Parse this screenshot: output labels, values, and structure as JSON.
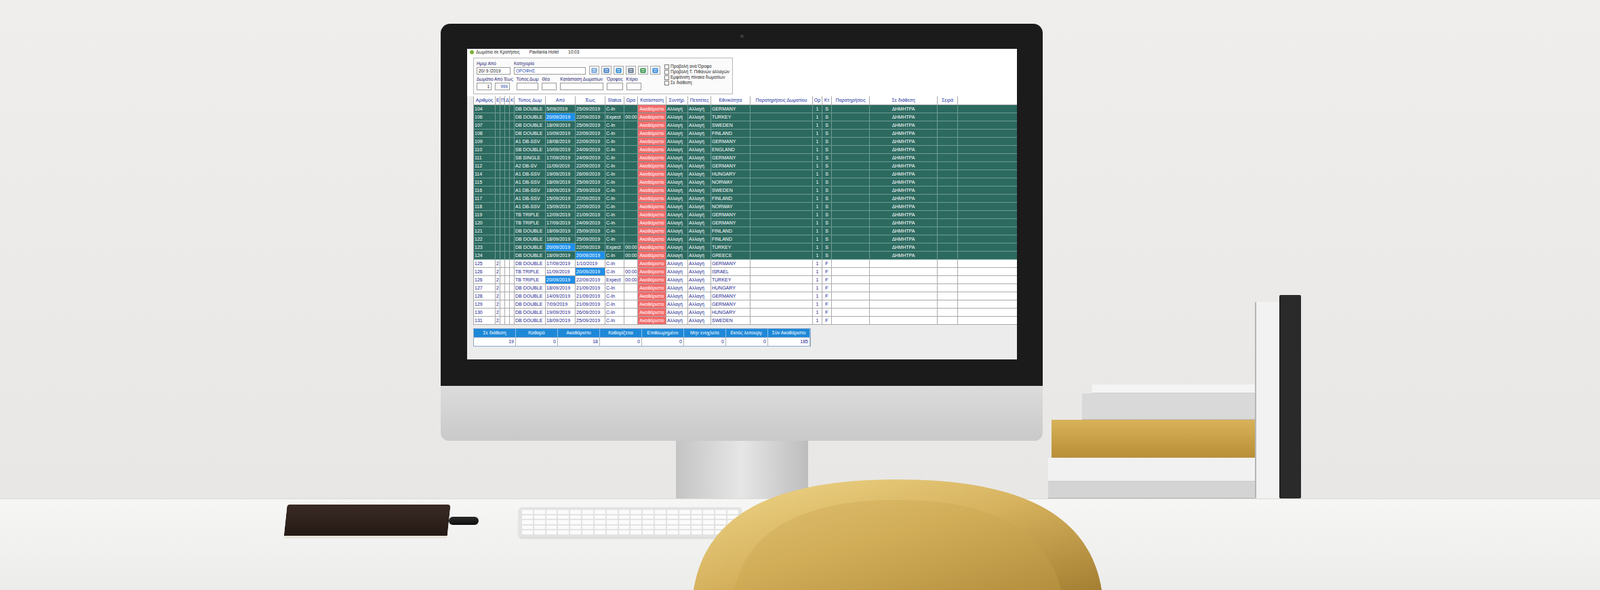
{
  "window": {
    "title": "Δωμάτια σε Κρατήσεις",
    "hotel": "Pavilania Hotel",
    "time": "10:03"
  },
  "filters": {
    "date_label": "Ημερ Από",
    "date": "20/ 9 /2019",
    "category_label": "Κατηγορία",
    "category": "ΟΡΟΦΗΣ",
    "room_range_label": "Δωμάτιο Από Έως",
    "room_from": "1",
    "room_to": "999",
    "fields": [
      {
        "label": "Τύπος Δωμ",
        "value": ""
      },
      {
        "label": "Θέα",
        "value": ""
      },
      {
        "label": "Κατάσταση Δωματίων",
        "value": ""
      },
      {
        "label": "Όροφος",
        "value": ""
      },
      {
        "label": "Κτίριο",
        "value": ""
      }
    ],
    "checkboxes": [
      {
        "label": "Προβολή ανά Όροφο",
        "checked": false
      },
      {
        "label": "Προβολή Τ. Πιθανών αλλαγών",
        "checked": false
      },
      {
        "label": "Εμφάνιση πίνακα δωματίων",
        "checked": false
      },
      {
        "label": "Σε διάθεση",
        "checked": false
      }
    ]
  },
  "table": {
    "columns": [
      "Αριθμός",
      "Ε",
      "Π",
      "Δ",
      "Κ",
      "Τύπος Δωμ",
      "Από",
      "Έως",
      "Status",
      "Ωρα",
      "Κατάσταση",
      "Συντήρ.",
      "Πετσέτες",
      "Εθνικότητα",
      "Παρατηρήσεις Δωματίου",
      "Ορ",
      "Κτ",
      "Παρατηρήσεις",
      "Σε διάθεση",
      "Σειρά"
    ],
    "rows": [
      {
        "cells": [
          "104",
          "",
          "",
          "",
          "",
          "DB DOUBLE",
          "5/09/2019",
          "25/09/2019",
          "C-In",
          "",
          "Ακαθάριστο",
          "Αλλαγή",
          "Αλλαγή",
          "GERMANY",
          "",
          "1",
          "S",
          "",
          "ΔΗΜΗΤΡΑ",
          ""
        ],
        "assigned": true,
        "from_selected": false,
        "to_selected": false
      },
      {
        "cells": [
          "106",
          "",
          "",
          "",
          "",
          "DB DOUBLE",
          "20/09/2019",
          "22/09/2019",
          "Expect",
          "00:00",
          "Ακαθάριστο",
          "Αλλαγή",
          "Αλλαγή",
          "TURKEY",
          "",
          "1",
          "S",
          "",
          "ΔΗΜΗΤΡΑ",
          ""
        ],
        "assigned": true,
        "from_selected": true,
        "to_selected": false
      },
      {
        "cells": [
          "107",
          "",
          "",
          "",
          "",
          "DB DOUBLE",
          "18/09/2019",
          "25/09/2019",
          "C-In",
          "",
          "Ακαθάριστο",
          "Αλλαγή",
          "Αλλαγή",
          "SWEDEN",
          "",
          "1",
          "S",
          "",
          "ΔΗΜΗΤΡΑ",
          ""
        ],
        "assigned": true,
        "from_selected": false,
        "to_selected": false
      },
      {
        "cells": [
          "108",
          "",
          "",
          "",
          "",
          "DB DOUBLE",
          "10/09/2019",
          "22/09/2019",
          "C-In",
          "",
          "Ακαθάριστο",
          "Αλλαγή",
          "Αλλαγή",
          "FINLAND",
          "",
          "1",
          "S",
          "",
          "ΔΗΜΗΤΡΑ",
          ""
        ],
        "assigned": true,
        "from_selected": false,
        "to_selected": false
      },
      {
        "cells": [
          "109",
          "",
          "",
          "",
          "",
          "A1 DB-SSV",
          "18/08/2019",
          "22/09/2019",
          "C-In",
          "",
          "Ακαθάριστο",
          "Αλλαγή",
          "Αλλαγή",
          "GERMANY",
          "",
          "1",
          "S",
          "",
          "ΔΗΜΗΤΡΑ",
          ""
        ],
        "assigned": true,
        "from_selected": false,
        "to_selected": false
      },
      {
        "cells": [
          "110",
          "",
          "",
          "",
          "",
          "SB DOUBLE",
          "10/09/2019",
          "24/09/2019",
          "C-In",
          "",
          "Ακαθάριστο",
          "Αλλαγή",
          "Αλλαγή",
          "ENGLAND",
          "",
          "1",
          "S",
          "",
          "ΔΗΜΗΤΡΑ",
          ""
        ],
        "assigned": true,
        "from_selected": false,
        "to_selected": false
      },
      {
        "cells": [
          "111",
          "",
          "",
          "",
          "",
          "SB SINGLE",
          "17/09/2019",
          "24/09/2019",
          "C-In",
          "",
          "Ακαθάριστο",
          "Αλλαγή",
          "Αλλαγή",
          "GERMANY",
          "",
          "1",
          "S",
          "",
          "ΔΗΜΗΤΡΑ",
          ""
        ],
        "assigned": true,
        "from_selected": false,
        "to_selected": false
      },
      {
        "cells": [
          "112",
          "",
          "",
          "",
          "",
          "A2 DB-SV",
          "11/09/2019",
          "22/09/2019",
          "C-In",
          "",
          "Ακαθάριστο",
          "Αλλαγή",
          "Αλλαγή",
          "GERMANY",
          "",
          "1",
          "S",
          "",
          "ΔΗΜΗΤΡΑ",
          ""
        ],
        "assigned": true,
        "from_selected": false,
        "to_selected": false
      },
      {
        "cells": [
          "114",
          "",
          "",
          "",
          "",
          "A1 DB-SSV",
          "19/09/2019",
          "26/09/2019",
          "C-In",
          "",
          "Ακαθάριστο",
          "Αλλαγή",
          "Αλλαγή",
          "HUNGARY",
          "",
          "1",
          "S",
          "",
          "ΔΗΜΗΤΡΑ",
          ""
        ],
        "assigned": true,
        "from_selected": false,
        "to_selected": false
      },
      {
        "cells": [
          "115",
          "",
          "",
          "",
          "",
          "A1 DB-SSV",
          "18/09/2019",
          "25/09/2019",
          "C-In",
          "",
          "Ακαθάριστο",
          "Αλλαγή",
          "Αλλαγή",
          "NORWAY",
          "",
          "1",
          "S",
          "",
          "ΔΗΜΗΤΡΑ",
          ""
        ],
        "assigned": true,
        "from_selected": false,
        "to_selected": false
      },
      {
        "cells": [
          "116",
          "",
          "",
          "",
          "",
          "A1 DB-SSV",
          "18/09/2019",
          "25/09/2019",
          "C-In",
          "",
          "Ακαθάριστο",
          "Αλλαγή",
          "Αλλαγή",
          "SWEDEN",
          "",
          "1",
          "S",
          "",
          "ΔΗΜΗΤΡΑ",
          ""
        ],
        "assigned": true,
        "from_selected": false,
        "to_selected": false
      },
      {
        "cells": [
          "117",
          "",
          "",
          "",
          "",
          "A1 DB-SSV",
          "15/09/2019",
          "22/09/2019",
          "C-In",
          "",
          "Ακαθάριστο",
          "Αλλαγή",
          "Αλλαγή",
          "FINLAND",
          "",
          "1",
          "S",
          "",
          "ΔΗΜΗΤΡΑ",
          ""
        ],
        "assigned": true,
        "from_selected": false,
        "to_selected": false
      },
      {
        "cells": [
          "118",
          "",
          "",
          "",
          "",
          "A1 DB-SSV",
          "15/09/2019",
          "22/09/2019",
          "C-In",
          "",
          "Ακαθάριστο",
          "Αλλαγή",
          "Αλλαγή",
          "NORWAY",
          "",
          "1",
          "S",
          "",
          "ΔΗΜΗΤΡΑ",
          ""
        ],
        "assigned": true,
        "from_selected": false,
        "to_selected": false
      },
      {
        "cells": [
          "119",
          "",
          "",
          "",
          "",
          "TB TRIPLE",
          "12/09/2019",
          "21/09/2019",
          "C-In",
          "",
          "Ακαθάριστο",
          "Αλλαγή",
          "Αλλαγή",
          "GERMANY",
          "",
          "1",
          "S",
          "",
          "ΔΗΜΗΤΡΑ",
          ""
        ],
        "assigned": true,
        "from_selected": false,
        "to_selected": false
      },
      {
        "cells": [
          "120",
          "",
          "",
          "",
          "",
          "TB TRIPLE",
          "17/09/2019",
          "24/09/2019",
          "C-In",
          "",
          "Ακαθάριστο",
          "Αλλαγή",
          "Αλλαγή",
          "GERMANY",
          "",
          "1",
          "S",
          "",
          "ΔΗΜΗΤΡΑ",
          ""
        ],
        "assigned": true,
        "from_selected": false,
        "to_selected": false
      },
      {
        "cells": [
          "121",
          "",
          "",
          "",
          "",
          "DB DOUBLE",
          "18/09/2019",
          "25/09/2019",
          "C-In",
          "",
          "Ακαθάριστο",
          "Αλλαγή",
          "Αλλαγή",
          "FINLAND",
          "",
          "1",
          "S",
          "",
          "ΔΗΜΗΤΡΑ",
          ""
        ],
        "assigned": true,
        "from_selected": false,
        "to_selected": false
      },
      {
        "cells": [
          "122",
          "",
          "",
          "",
          "",
          "DB DOUBLE",
          "18/09/2019",
          "25/09/2019",
          "C-In",
          "",
          "Ακαθάριστο",
          "Αλλαγή",
          "Αλλαγή",
          "FINLAND",
          "",
          "1",
          "S",
          "",
          "ΔΗΜΗΤΡΑ",
          ""
        ],
        "assigned": true,
        "from_selected": false,
        "to_selected": false
      },
      {
        "cells": [
          "123",
          "",
          "",
          "",
          "",
          "DB DOUBLE",
          "20/09/2019",
          "22/09/2019",
          "Expect",
          "00:00",
          "Ακαθάριστο",
          "Αλλαγή",
          "Αλλαγή",
          "TURKEY",
          "",
          "1",
          "S",
          "",
          "ΔΗΜΗΤΡΑ",
          ""
        ],
        "assigned": true,
        "from_selected": true,
        "to_selected": false
      },
      {
        "cells": [
          "124",
          "",
          "",
          "",
          "",
          "DB DOUBLE",
          "18/09/2019",
          "20/09/2019",
          "C-In",
          "00:00",
          "Ακαθάριστο",
          "Αλλαγή",
          "Αλλαγή",
          "GREECE",
          "",
          "1",
          "S",
          "",
          "ΔΗΜΗΤΡΑ",
          ""
        ],
        "assigned": true,
        "from_selected": false,
        "to_selected": true
      },
      {
        "cells": [
          "125",
          "2",
          "",
          "",
          "",
          "DB DOUBLE",
          "17/09/2019",
          "1/10/2019",
          "C-In",
          "",
          "Ακαθάριστο",
          "Αλλαγή",
          "Αλλαγή",
          "GERMANY",
          "",
          "1",
          "F",
          "",
          "",
          ""
        ],
        "assigned": false,
        "from_selected": false,
        "to_selected": false
      },
      {
        "cells": [
          "126",
          "2",
          "",
          "",
          "",
          "TB TRIPLE",
          "11/09/2019",
          "20/09/2019",
          "C-In",
          "00:00",
          "Ακαθάριστο",
          "Αλλαγή",
          "Αλλαγή",
          "ISRAEL",
          "",
          "1",
          "F",
          "",
          "",
          ""
        ],
        "assigned": false,
        "from_selected": false,
        "to_selected": true
      },
      {
        "cells": [
          "126",
          "2",
          "",
          "",
          "",
          "TB TRIPLE",
          "20/09/2019",
          "22/09/2019",
          "Expect",
          "00:00",
          "Ακαθάριστο",
          "Αλλαγή",
          "Αλλαγή",
          "TURKEY",
          "",
          "1",
          "F",
          "",
          "",
          ""
        ],
        "assigned": false,
        "from_selected": true,
        "to_selected": false
      },
      {
        "cells": [
          "127",
          "2",
          "",
          "",
          "",
          "DB DOUBLE",
          "18/09/2019",
          "21/09/2019",
          "C-In",
          "",
          "Ακαθάριστο",
          "Αλλαγή",
          "Αλλαγή",
          "HUNGARY",
          "",
          "1",
          "F",
          "",
          "",
          ""
        ],
        "assigned": false,
        "from_selected": false,
        "to_selected": false
      },
      {
        "cells": [
          "128",
          "2",
          "",
          "",
          "",
          "DB DOUBLE",
          "14/09/2019",
          "21/09/2019",
          "C-In",
          "",
          "Ακαθάριστο",
          "Αλλαγή",
          "Αλλαγή",
          "GERMANY",
          "",
          "1",
          "F",
          "",
          "",
          ""
        ],
        "assigned": false,
        "from_selected": false,
        "to_selected": false
      },
      {
        "cells": [
          "129",
          "2",
          "",
          "",
          "",
          "DB DOUBLE",
          "7/09/2019",
          "21/09/2019",
          "C-In",
          "",
          "Ακαθάριστο",
          "Αλλαγή",
          "Αλλαγή",
          "GERMANY",
          "",
          "1",
          "F",
          "",
          "",
          ""
        ],
        "assigned": false,
        "from_selected": false,
        "to_selected": false
      },
      {
        "cells": [
          "130",
          "2",
          "",
          "",
          "",
          "DB DOUBLE",
          "19/09/2019",
          "26/09/2019",
          "C-In",
          "",
          "Ακαθάριστο",
          "Αλλαγή",
          "Αλλαγή",
          "HUNGARY",
          "",
          "1",
          "F",
          "",
          "",
          ""
        ],
        "assigned": false,
        "from_selected": false,
        "to_selected": false
      },
      {
        "cells": [
          "131",
          "2",
          "",
          "",
          "",
          "DB DOUBLE",
          "18/09/2019",
          "25/09/2019",
          "C-In",
          "",
          "Ακαθάριστο",
          "Αλλαγή",
          "Αλλαγή",
          "SWEDEN",
          "",
          "1",
          "F",
          "",
          "",
          ""
        ],
        "assigned": false,
        "from_selected": false,
        "to_selected": false
      }
    ]
  },
  "summary": {
    "columns": [
      "Σε διάθεση",
      "Καθαρό",
      "Ακαθάριστο",
      "Καθαρίζεται",
      "Επιθεωρημένο",
      "Μην ενοχλείτε",
      "Εκτός λειτουργ.",
      "Σύν Ακαθάριστο"
    ],
    "values": [
      "19",
      "0",
      "18",
      "0",
      "0",
      "0",
      "0",
      "185"
    ]
  }
}
